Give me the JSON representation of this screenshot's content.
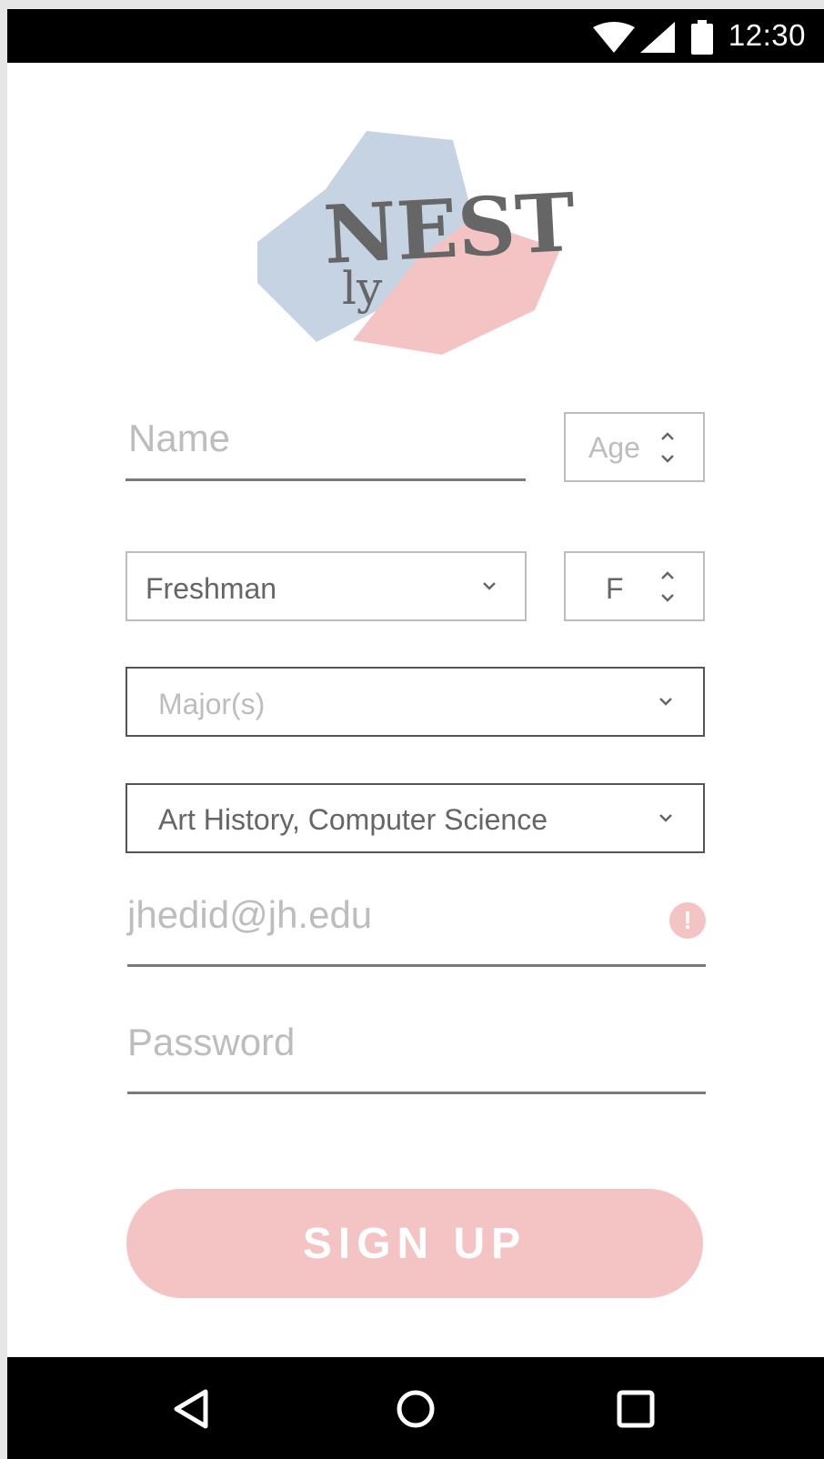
{
  "status_bar": {
    "time": "12:30",
    "icons": [
      "wifi-icon",
      "cell-signal-icon",
      "battery-icon"
    ]
  },
  "logo": {
    "text_main": "NEST",
    "text_sub": "ly",
    "colors": {
      "blue": "#c5d3e3",
      "pink": "#f4c4c4",
      "ink": "#666666"
    }
  },
  "form": {
    "name": {
      "placeholder": "Name"
    },
    "age": {
      "placeholder": "Age"
    },
    "year": {
      "value": "Freshman"
    },
    "gender": {
      "value": "F"
    },
    "majors": {
      "placeholder": "Major(s)"
    },
    "majors_selected": {
      "value": "Art History, Computer Science"
    },
    "email": {
      "value": "jhedid@jh.edu",
      "alert_symbol": "!"
    },
    "password": {
      "placeholder": "Password"
    }
  },
  "signup_button": {
    "label": "SIGN UP"
  },
  "nav_bar": {
    "icons": [
      "back-icon",
      "home-icon",
      "recents-icon"
    ]
  },
  "colors": {
    "accent": "#f4c4c4",
    "placeholder_text": "#bdbdbd",
    "value_text": "#666666",
    "underline": "#7a7a7a"
  }
}
